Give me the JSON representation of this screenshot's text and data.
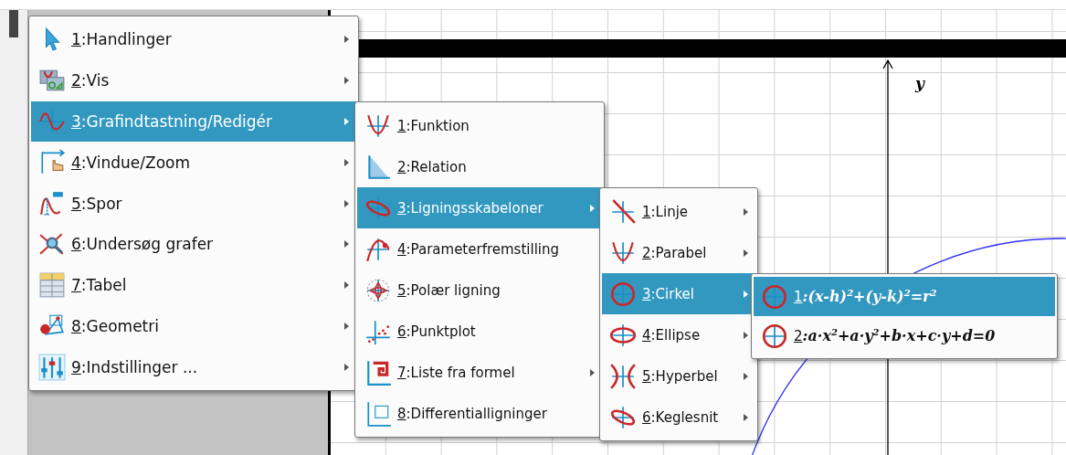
{
  "graph": {
    "axis_label": "y"
  },
  "menus": [
    {
      "items": [
        {
          "number": "1",
          "label": ":Handlinger",
          "kind": "cursor",
          "has_submenu": true,
          "selected": false
        },
        {
          "number": "2",
          "label": ":Vis",
          "kind": "view",
          "has_submenu": true,
          "selected": false
        },
        {
          "number": "3",
          "label": ":Grafindtastning/Redigér",
          "kind": "sine",
          "has_submenu": true,
          "selected": true
        },
        {
          "number": "4",
          "label": ":Vindue/Zoom",
          "kind": "zoom",
          "has_submenu": true,
          "selected": false
        },
        {
          "number": "5",
          "label": ":Spor",
          "kind": "trace",
          "has_submenu": true,
          "selected": false
        },
        {
          "number": "6",
          "label": ":Undersøg grafer",
          "kind": "inspect",
          "has_submenu": true,
          "selected": false
        },
        {
          "number": "7",
          "label": ":Tabel",
          "kind": "table",
          "has_submenu": true,
          "selected": false
        },
        {
          "number": "8",
          "label": ":Geometri",
          "kind": "geometry",
          "has_submenu": true,
          "selected": false
        },
        {
          "number": "9",
          "label": ":Indstillinger ...",
          "kind": "settings",
          "has_submenu": true,
          "selected": false
        }
      ]
    },
    {
      "items": [
        {
          "number": "1",
          "label": ":Funktion",
          "kind": "parabola",
          "has_submenu": false,
          "selected": false
        },
        {
          "number": "2",
          "label": ":Relation",
          "kind": "relation",
          "has_submenu": false,
          "selected": false
        },
        {
          "number": "3",
          "label": ":Ligningsskabeloner",
          "kind": "tilted",
          "has_submenu": true,
          "selected": true
        },
        {
          "number": "4",
          "label": ":Parameterfremstilling",
          "kind": "parametric",
          "has_submenu": false,
          "selected": false
        },
        {
          "number": "5",
          "label": ":Polær ligning",
          "kind": "polar",
          "has_submenu": false,
          "selected": false
        },
        {
          "number": "6",
          "label": ":Punktplot",
          "kind": "scatter",
          "has_submenu": false,
          "selected": false
        },
        {
          "number": "7",
          "label": ":Liste fra formel",
          "kind": "sequence",
          "has_submenu": true,
          "selected": false
        },
        {
          "number": "8",
          "label": ":Differentialligninger",
          "kind": "diffeq",
          "has_submenu": false,
          "selected": false
        }
      ]
    },
    {
      "items": [
        {
          "number": "1",
          "label": ":Linje",
          "kind": "line",
          "has_submenu": true,
          "selected": false
        },
        {
          "number": "2",
          "label": ":Parabel",
          "kind": "parabola",
          "has_submenu": true,
          "selected": false
        },
        {
          "number": "3",
          "label": ":Cirkel",
          "kind": "circle",
          "has_submenu": true,
          "selected": true
        },
        {
          "number": "4",
          "label": ":Ellipse",
          "kind": "ellipse",
          "has_submenu": true,
          "selected": false
        },
        {
          "number": "5",
          "label": ":Hyperbel",
          "kind": "hyperbola",
          "has_submenu": true,
          "selected": false
        },
        {
          "number": "6",
          "label": ":Keglesnit",
          "kind": "tilted",
          "has_submenu": true,
          "selected": false
        }
      ]
    },
    {
      "items": [
        {
          "number": "1",
          "label": ":(x-h)$^{2}$+(y-k)$^{2}$=r$^{2}$",
          "kind": "circle",
          "has_submenu": false,
          "selected": true
        },
        {
          "number": "2",
          "label": ":a·x$^{2}$+a·y$^{2}$+b·x+c·y+d=0",
          "kind": "circle",
          "has_submenu": false,
          "selected": false
        }
      ]
    }
  ]
}
